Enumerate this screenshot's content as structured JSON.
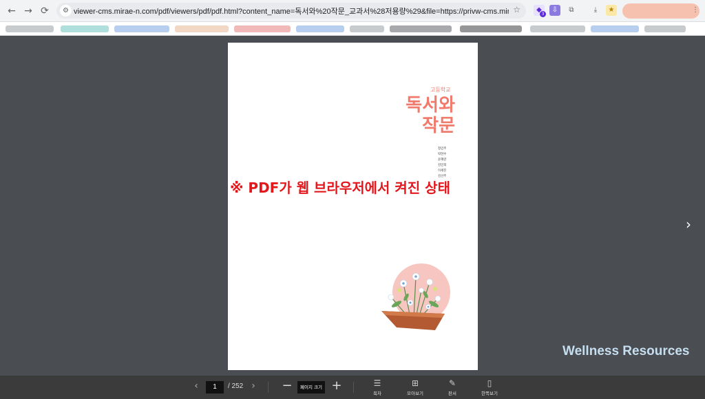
{
  "browser": {
    "url": "viewer-cms.mirae-n.com/pdf/viewers/pdf/pdf.html?content_name=독서와%20작문_교과서%28저용량%29&file=https://privw-cms.mirae-n.com/doc...",
    "back_icon": "arrow-left-icon",
    "forward_icon": "arrow-right-icon",
    "reload_icon": "reload-icon",
    "extension_badge": "3"
  },
  "document": {
    "school": "고등학교",
    "title_line1": "독서와",
    "title_line2": "작문",
    "authors": [
      "정민주",
      "박현수",
      "윤혜란",
      "김민희",
      "이세진",
      "김선주"
    ]
  },
  "overlay_text": "※ PDF가 웹 브라우저에서 켜진 상태",
  "watermark": "Wellness Resources",
  "toolbar": {
    "current_page": "1",
    "total_pages": "/ 252",
    "zoom_label": "페이지 크기",
    "tools": [
      {
        "icon": "toc-icon",
        "label": "목차"
      },
      {
        "icon": "grid-icon",
        "label": "모아보기"
      },
      {
        "icon": "edit-icon",
        "label": "판서"
      },
      {
        "icon": "single-page-icon",
        "label": "한쪽보기"
      }
    ]
  },
  "colors": {
    "accent": "#f07a6c",
    "overlay": "#e2181d",
    "viewer_bg": "#4a4d51",
    "toolbar_bg": "#3b3b3b"
  }
}
